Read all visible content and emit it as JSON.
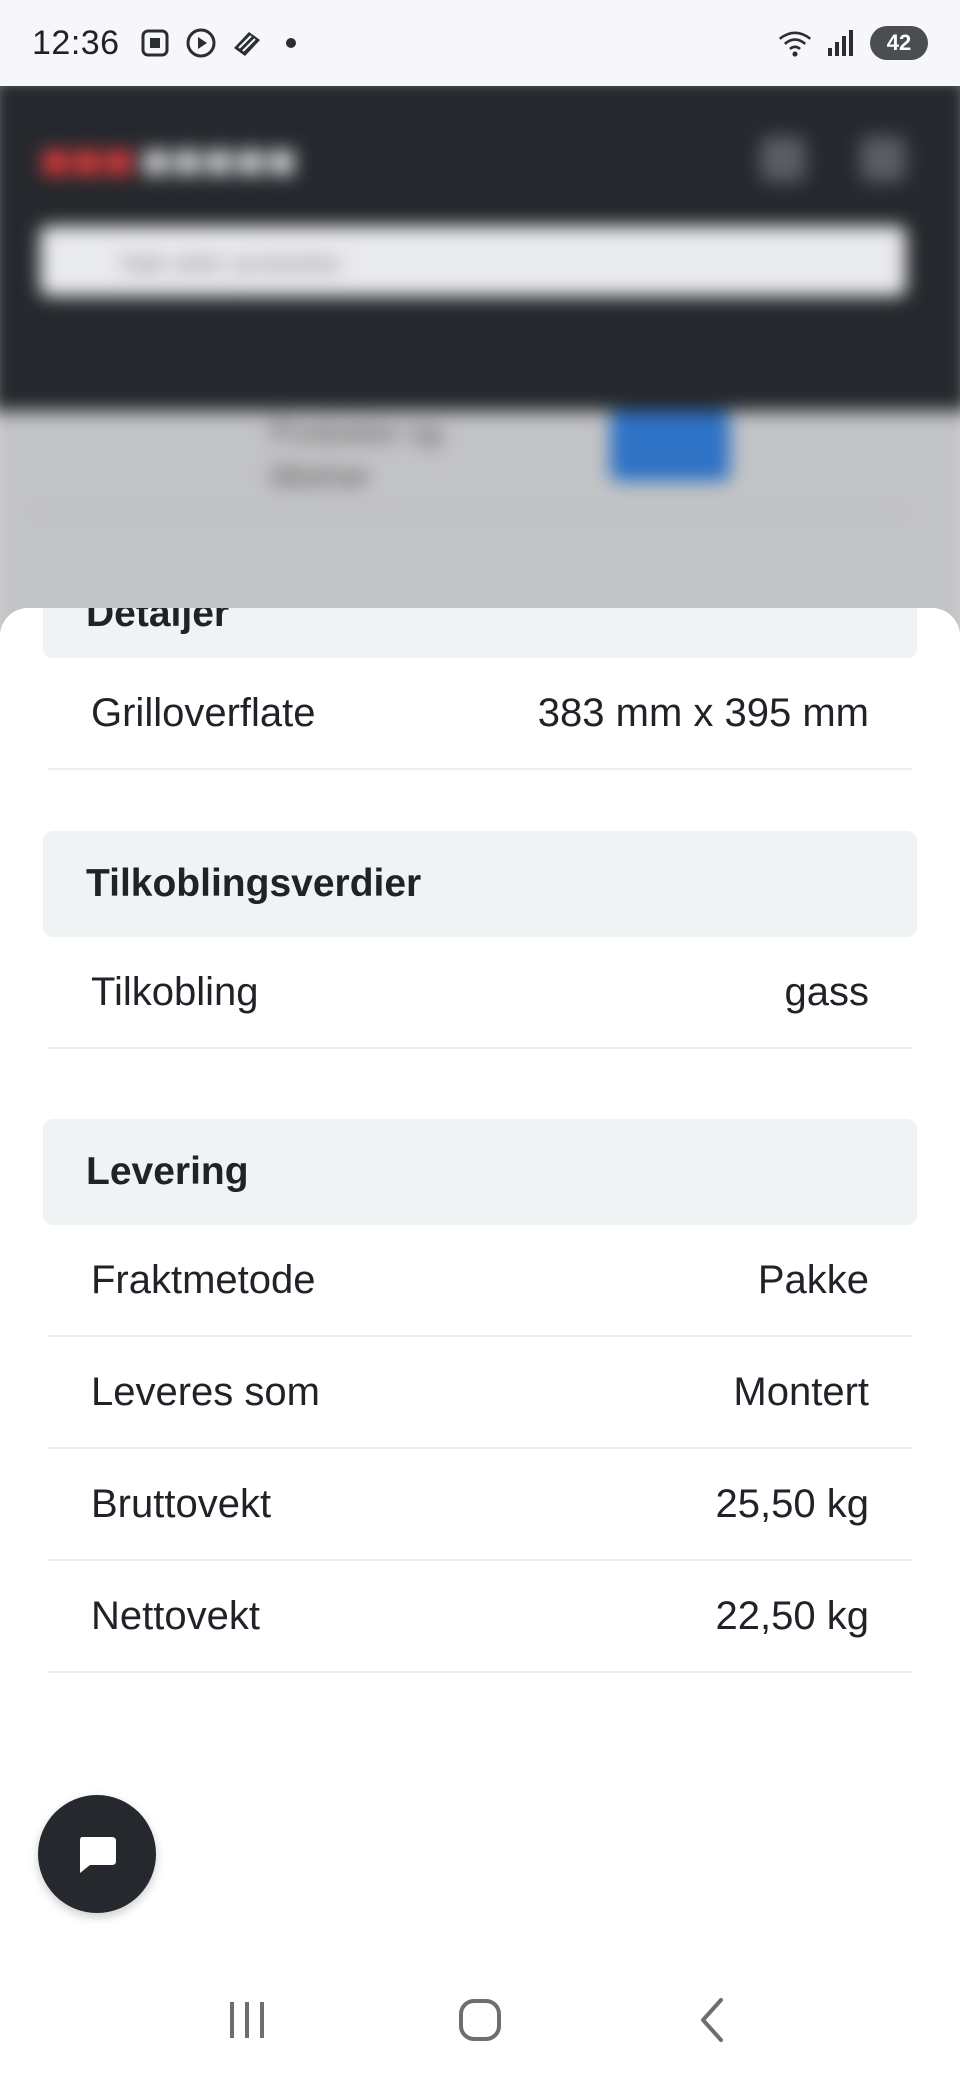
{
  "status_bar": {
    "time": "12:36",
    "left_icons": [
      "screenshot-icon",
      "play-circle-icon",
      "app-icon",
      "notification-dot-icon"
    ],
    "right_icons": [
      "wifi-icon",
      "signal-icon"
    ],
    "battery": "42"
  },
  "background_page": {
    "search_placeholder": "Søk etter produkter",
    "blurred_text": "Produkter og tilbehør"
  },
  "sheet": {
    "partial_section_title": "Detaljer",
    "sections": [
      {
        "rows": [
          {
            "label": "Grilloverflate",
            "value": "383 mm x 395 mm"
          }
        ]
      },
      {
        "title": "Tilkoblingsverdier",
        "rows": [
          {
            "label": "Tilkobling",
            "value": "gass"
          }
        ]
      },
      {
        "title": "Levering",
        "rows": [
          {
            "label": "Fraktmetode",
            "value": "Pakke"
          },
          {
            "label": "Leveres som",
            "value": "Montert"
          },
          {
            "label": "Bruttovekt",
            "value": "25,50 kg"
          },
          {
            "label": "Nettovekt",
            "value": "22,50 kg"
          }
        ]
      }
    ]
  },
  "chat": {
    "icon": "chat-icon"
  },
  "nav": {
    "icons": [
      "recent-apps-icon",
      "home-icon",
      "back-icon"
    ]
  }
}
